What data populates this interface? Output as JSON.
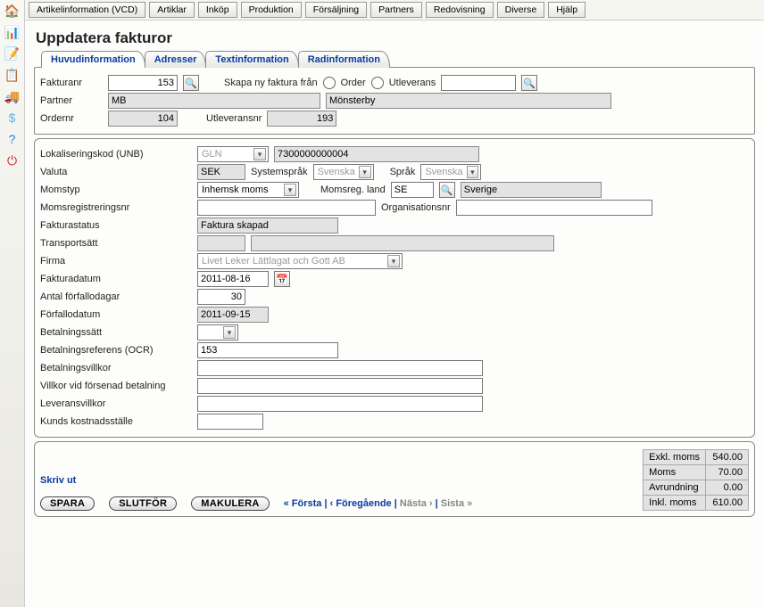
{
  "topnav": [
    "Artikelinformation (VCD)",
    "Artiklar",
    "Inköp",
    "Produktion",
    "Försäljning",
    "Partners",
    "Redovisning",
    "Diverse",
    "Hjälp"
  ],
  "title": "Uppdatera fakturor",
  "tabs": [
    "Huvudinformation",
    "Adresser",
    "Textinformation",
    "Radinformation"
  ],
  "panel1": {
    "fakturanr_label": "Fakturanr",
    "fakturanr": "153",
    "skapa_label": "Skapa ny faktura från",
    "order_label": "Order",
    "utl_label": "Utleverans",
    "utl_value": "",
    "partner_label": "Partner",
    "partner_code": "MB",
    "partner_name": "Mönsterby",
    "ordernr_label": "Ordernr",
    "ordernr": "104",
    "utlnr_label": "Utleveransnr",
    "utlnr": "193"
  },
  "panel2": {
    "lok_label": "Lokaliseringskod (UNB)",
    "lok_type": "GLN",
    "lok_value": "7300000000004",
    "valuta_label": "Valuta",
    "valuta": "SEK",
    "sysspr_label": "Systemspråk",
    "sysspr": "Svenska",
    "spr_label": "Språk",
    "spr": "Svenska",
    "momstyp_label": "Momstyp",
    "momstyp": "Inhemsk moms",
    "momsland_label": "Momsreg. land",
    "momsland": "SE",
    "momsland_name": "Sverige",
    "momsreg_label": "Momsregistreringsnr",
    "momsreg": "",
    "orgnr_label": "Organisationsnr",
    "orgnr": "",
    "fstatus_label": "Fakturastatus",
    "fstatus": "Faktura skapad",
    "transport_label": "Transportsätt",
    "transport1": "",
    "transport2": "",
    "firma_label": "Firma",
    "firma": "Livet Leker Lättlagat och Gott AB",
    "fdatum_label": "Fakturadatum",
    "fdatum": "2011-08-16",
    "antal_label": "Antal förfallodagar",
    "antal": "30",
    "forf_label": "Förfallodatum",
    "forf": "2011-09-15",
    "bsatt_label": "Betalningssätt",
    "bsatt": "",
    "ocr_label": "Betalningsreferens (OCR)",
    "ocr": "153",
    "bvill_label": "Betalningsvillkor",
    "bvill": "",
    "fvill_label": "Villkor vid försenad betalning",
    "fvill": "",
    "lvill_label": "Leveransvillkor",
    "lvill": "",
    "kost_label": "Kunds kostnadsställe",
    "kost": ""
  },
  "footer": {
    "skriv": "Skriv ut",
    "spara": "SPARA",
    "slutfor": "SLUTFÖR",
    "makulera": "MAKULERA",
    "first": "« Första",
    "prev": "‹ Föregående",
    "next": "Nästa ›",
    "last": "Sista »",
    "sep": " | ",
    "totals": [
      {
        "label": "Exkl. moms",
        "value": "540.00"
      },
      {
        "label": "Moms",
        "value": "70.00"
      },
      {
        "label": "Avrundning",
        "value": "0.00"
      },
      {
        "label": "Inkl. moms",
        "value": "610.00"
      }
    ]
  }
}
